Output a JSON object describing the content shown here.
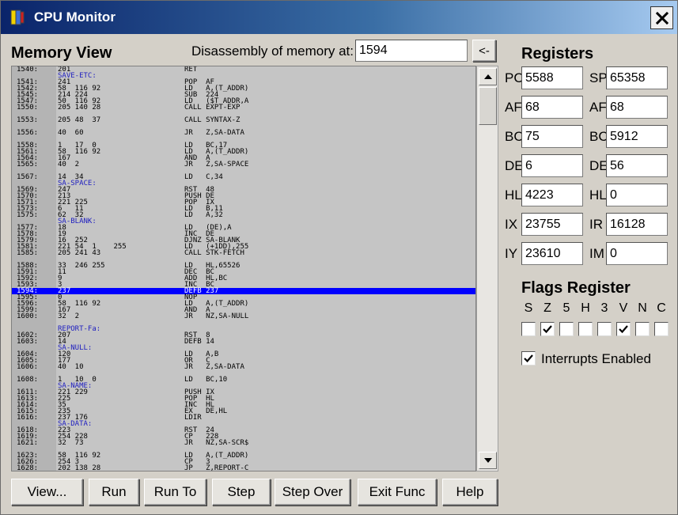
{
  "window": {
    "title": "CPU Monitor"
  },
  "memory": {
    "heading": "Memory View",
    "disasm_label": "Disassembly of memory at:",
    "address_value": "1594",
    "go_button": "<-",
    "lines": [
      {
        "t": "code",
        "addr": "1540:",
        "bytes": "201",
        "instr": "RET"
      },
      {
        "t": "label",
        "text": "SAVE-ETC:"
      },
      {
        "t": "code",
        "addr": "1541:",
        "bytes": "241",
        "instr": "POP  AF"
      },
      {
        "t": "code",
        "addr": "1542:",
        "bytes": "58  116 92",
        "instr": "LD   A,(T_ADDR)"
      },
      {
        "t": "code",
        "addr": "1545:",
        "bytes": "214 224",
        "instr": "SUB  224"
      },
      {
        "t": "code",
        "addr": "1547:",
        "bytes": "50  116 92",
        "instr": "LD   ($T_ADDR,A"
      },
      {
        "t": "code",
        "addr": "1550:",
        "bytes": "205 140 28",
        "instr": "CALL EXPT-EXP"
      },
      {
        "t": "gap"
      },
      {
        "t": "code",
        "addr": "1553:",
        "bytes": "205 48  37",
        "instr": "CALL SYNTAX-Z"
      },
      {
        "t": "gap"
      },
      {
        "t": "code",
        "addr": "1556:",
        "bytes": "40  60",
        "instr": "JR   Z,SA-DATA"
      },
      {
        "t": "gap"
      },
      {
        "t": "code",
        "addr": "1558:",
        "bytes": "1   17  0",
        "instr": "LD   BC,17"
      },
      {
        "t": "code",
        "addr": "1561:",
        "bytes": "58  116 92",
        "instr": "LD   A,(T_ADDR)"
      },
      {
        "t": "code",
        "addr": "1564:",
        "bytes": "167",
        "instr": "AND  A"
      },
      {
        "t": "code",
        "addr": "1565:",
        "bytes": "40  2",
        "instr": "JR   Z,SA-SPACE"
      },
      {
        "t": "gap"
      },
      {
        "t": "code",
        "addr": "1567:",
        "bytes": "14  34",
        "instr": "LD   C,34"
      },
      {
        "t": "label",
        "text": "SA-SPACE:"
      },
      {
        "t": "code",
        "addr": "1569:",
        "bytes": "247",
        "instr": "RST  48"
      },
      {
        "t": "code",
        "addr": "1570:",
        "bytes": "213",
        "instr": "PUSH DE"
      },
      {
        "t": "code",
        "addr": "1571:",
        "bytes": "221 225",
        "instr": "POP  IX"
      },
      {
        "t": "code",
        "addr": "1573:",
        "bytes": "6   11",
        "instr": "LD   B,11"
      },
      {
        "t": "code",
        "addr": "1575:",
        "bytes": "62  32",
        "instr": "LD   A,32"
      },
      {
        "t": "label",
        "text": "SA-BLANK:"
      },
      {
        "t": "code",
        "addr": "1577:",
        "bytes": "18",
        "instr": "LD   (DE),A"
      },
      {
        "t": "code",
        "addr": "1578:",
        "bytes": "19",
        "instr": "INC  DE"
      },
      {
        "t": "code",
        "addr": "1579:",
        "bytes": "16  252",
        "instr": "DJNZ SA-BLANK"
      },
      {
        "t": "code",
        "addr": "1581:",
        "bytes": "221 54  1    255",
        "instr": "LD   (+1DD),255"
      },
      {
        "t": "code",
        "addr": "1585:",
        "bytes": "205 241 43",
        "instr": "CALL STK-FETCH"
      },
      {
        "t": "gap"
      },
      {
        "t": "code",
        "addr": "1588:",
        "bytes": "33  246 255",
        "instr": "LD   HL,65526"
      },
      {
        "t": "code",
        "addr": "1591:",
        "bytes": "11",
        "instr": "DEC  BC"
      },
      {
        "t": "code",
        "addr": "1592:",
        "bytes": "9",
        "instr": "ADD  HL,BC"
      },
      {
        "t": "code",
        "addr": "1593:",
        "bytes": "3",
        "instr": "INC  BC"
      },
      {
        "t": "code",
        "addr": "1594:",
        "bytes": "237",
        "instr": "DEFB 237",
        "selected": true
      },
      {
        "t": "code",
        "addr": "1595:",
        "bytes": "0",
        "instr": "NOP"
      },
      {
        "t": "code",
        "addr": "1596:",
        "bytes": "58  116 92",
        "instr": "LD   A,(T_ADDR)"
      },
      {
        "t": "code",
        "addr": "1599:",
        "bytes": "167",
        "instr": "AND  A"
      },
      {
        "t": "code",
        "addr": "1600:",
        "bytes": "32  2",
        "instr": "JR   NZ,SA-NULL"
      },
      {
        "t": "gap"
      },
      {
        "t": "label",
        "text": "REPORT-Fa:"
      },
      {
        "t": "code",
        "addr": "1602:",
        "bytes": "207",
        "instr": "RST  8"
      },
      {
        "t": "code",
        "addr": "1603:",
        "bytes": "14",
        "instr": "DEFB 14"
      },
      {
        "t": "label",
        "text": "SA-NULL:"
      },
      {
        "t": "code",
        "addr": "1604:",
        "bytes": "120",
        "instr": "LD   A,B"
      },
      {
        "t": "code",
        "addr": "1605:",
        "bytes": "177",
        "instr": "OR   C"
      },
      {
        "t": "code",
        "addr": "1606:",
        "bytes": "40  10",
        "instr": "JR   Z,SA-DATA"
      },
      {
        "t": "gap"
      },
      {
        "t": "code",
        "addr": "1608:",
        "bytes": "1   10  0",
        "instr": "LD   BC,10"
      },
      {
        "t": "label",
        "text": "SA-NAME:"
      },
      {
        "t": "code",
        "addr": "1611:",
        "bytes": "221 229",
        "instr": "PUSH IX"
      },
      {
        "t": "code",
        "addr": "1613:",
        "bytes": "225",
        "instr": "POP  HL"
      },
      {
        "t": "code",
        "addr": "1614:",
        "bytes": "35",
        "instr": "INC  HL"
      },
      {
        "t": "code",
        "addr": "1615:",
        "bytes": "235",
        "instr": "EX   DE,HL"
      },
      {
        "t": "code",
        "addr": "1616:",
        "bytes": "237 176",
        "instr": "LDIR"
      },
      {
        "t": "label",
        "text": "SA-DATA:"
      },
      {
        "t": "code",
        "addr": "1618:",
        "bytes": "223",
        "instr": "RST  24"
      },
      {
        "t": "code",
        "addr": "1619:",
        "bytes": "254 228",
        "instr": "CP   228"
      },
      {
        "t": "code",
        "addr": "1621:",
        "bytes": "32  73",
        "instr": "JR   NZ,SA-SCR$"
      },
      {
        "t": "gap"
      },
      {
        "t": "code",
        "addr": "1623:",
        "bytes": "58  116 92",
        "instr": "LD   A,(T_ADDR)"
      },
      {
        "t": "code",
        "addr": "1626:",
        "bytes": "254 3",
        "instr": "CP   3"
      },
      {
        "t": "code",
        "addr": "1628:",
        "bytes": "202 138 28",
        "instr": "JP   Z,REPORT-C"
      }
    ]
  },
  "registers": {
    "heading": "Registers",
    "items": [
      {
        "label": "PC",
        "value": "5588"
      },
      {
        "label": "SP",
        "value": "65358"
      },
      {
        "label": "AF",
        "value": "68"
      },
      {
        "label": "AF",
        "value": "68"
      },
      {
        "label": "BC",
        "value": "75"
      },
      {
        "label": "BC",
        "value": "5912"
      },
      {
        "label": "DE",
        "value": "6"
      },
      {
        "label": "DE",
        "value": "56"
      },
      {
        "label": "HL",
        "value": "4223"
      },
      {
        "label": "HL",
        "value": "0"
      },
      {
        "label": "IX",
        "value": "23755"
      },
      {
        "label": "IR",
        "value": "16128"
      },
      {
        "label": "IY",
        "value": "23610"
      },
      {
        "label": "IM",
        "value": "0"
      }
    ]
  },
  "flags": {
    "heading": "Flags Register",
    "items": [
      {
        "letter": "S",
        "checked": false
      },
      {
        "letter": "Z",
        "checked": true
      },
      {
        "letter": "5",
        "checked": false
      },
      {
        "letter": "H",
        "checked": false
      },
      {
        "letter": "3",
        "checked": false
      },
      {
        "letter": "V",
        "checked": true
      },
      {
        "letter": "N",
        "checked": false
      },
      {
        "letter": "C",
        "checked": false
      }
    ],
    "interrupts_label": "Interrupts Enabled",
    "interrupts_checked": true
  },
  "buttons": {
    "view": "View...",
    "run": "Run",
    "run_to": "Run To",
    "step": "Step",
    "step_over": "Step Over",
    "exit_func": "Exit Func",
    "help": "Help"
  }
}
